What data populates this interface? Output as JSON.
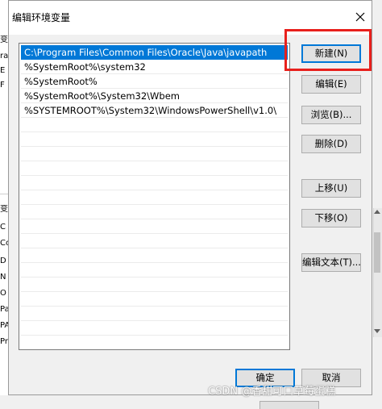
{
  "dialog": {
    "title": "编辑环境变量"
  },
  "path_list": {
    "items": [
      {
        "text": "C:\\Program Files\\Common Files\\Oracle\\Java\\javapath",
        "selected": true
      },
      {
        "text": "%SystemRoot%\\system32",
        "selected": false
      },
      {
        "text": "%SystemRoot%",
        "selected": false
      },
      {
        "text": "%SystemRoot%\\System32\\Wbem",
        "selected": false
      },
      {
        "text": "%SYSTEMROOT%\\System32\\WindowsPowerShell\\v1.0\\",
        "selected": false
      }
    ]
  },
  "buttons": {
    "new": "新建(N)",
    "edit": "编辑(E)",
    "browse": "浏览(B)...",
    "delete": "删除(D)",
    "move_up": "上移(U)",
    "move_down": "下移(O)",
    "edit_text": "编辑文本(T)...",
    "ok": "确定",
    "cancel": "取消"
  },
  "background_window": {
    "left_fragments": [
      "变",
      "ra",
      "E",
      "F",
      "变",
      "C",
      "Cc",
      "D",
      "N",
      "O",
      "Pa",
      "PA",
      "Pr"
    ]
  },
  "watermark": "CSDN @香甜可口草莓蛋糕",
  "colors": {
    "selection": "#0078d7",
    "highlight": "#e8201c",
    "dialog_bg": "#f0f0f0"
  }
}
